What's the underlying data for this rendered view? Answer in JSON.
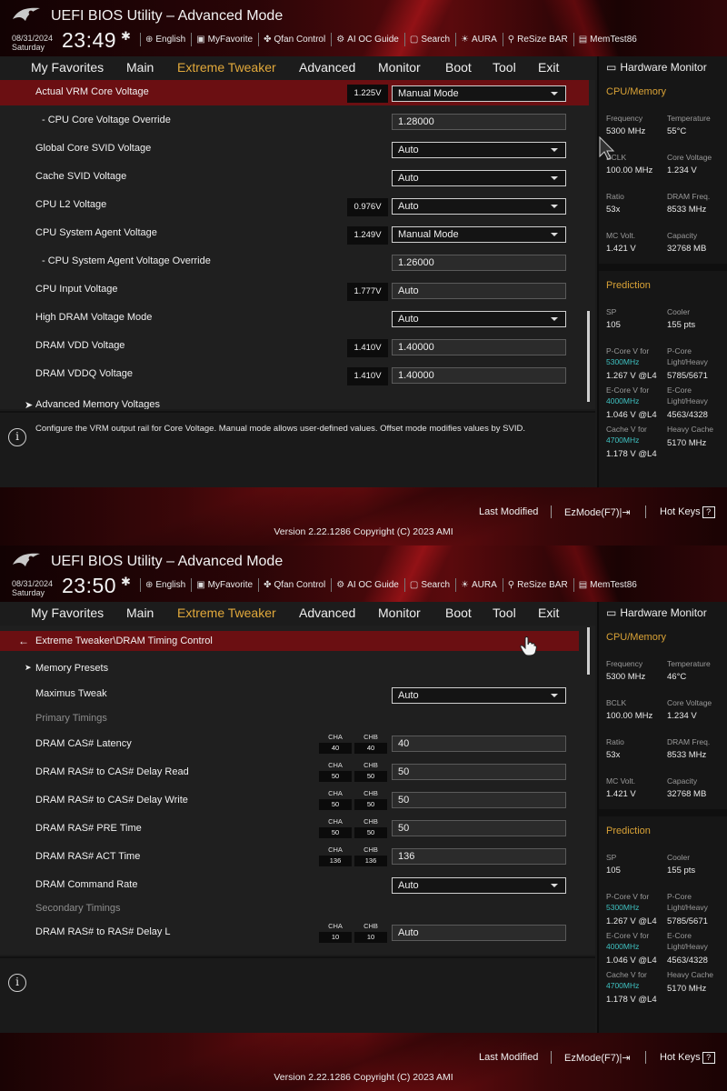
{
  "header": {
    "title": "UEFI BIOS Utility – Advanced Mode",
    "tools": [
      "English",
      "MyFavorite",
      "Qfan Control",
      "AI OC Guide",
      "Search",
      "AURA",
      "ReSize BAR",
      "MemTest86"
    ]
  },
  "nav": {
    "tabs": [
      "My Favorites",
      "Main",
      "Extreme Tweaker",
      "Advanced",
      "Monitor",
      "Boot",
      "Tool",
      "Exit"
    ],
    "active": "Extreme Tweaker"
  },
  "screen1": {
    "date": "08/31/2024",
    "day": "Saturday",
    "time": "23:49",
    "rows": [
      {
        "label": "Actual VRM Core Voltage",
        "reading": "1.225V",
        "value": "Manual Mode",
        "kind": "dropdown",
        "selected": true
      },
      {
        "label": "- CPU Core Voltage Override",
        "reading": "",
        "value": "1.28000",
        "kind": "field"
      },
      {
        "label": "Global Core SVID Voltage",
        "reading": "",
        "value": "Auto",
        "kind": "dropdown"
      },
      {
        "label": "Cache SVID Voltage",
        "reading": "",
        "value": "Auto",
        "kind": "dropdown"
      },
      {
        "label": "CPU L2 Voltage",
        "reading": "0.976V",
        "value": "Auto",
        "kind": "dropdown"
      },
      {
        "label": "CPU System Agent Voltage",
        "reading": "1.249V",
        "value": "Manual Mode",
        "kind": "dropdown"
      },
      {
        "label": "- CPU System Agent Voltage Override",
        "reading": "",
        "value": "1.26000",
        "kind": "field"
      },
      {
        "label": "CPU Input Voltage",
        "reading": "1.777V",
        "value": "Auto",
        "kind": "field"
      },
      {
        "label": "High DRAM Voltage Mode",
        "reading": "",
        "value": "Auto",
        "kind": "dropdown"
      },
      {
        "label": "DRAM VDD Voltage",
        "reading": "1.410V",
        "value": "1.40000",
        "kind": "field"
      },
      {
        "label": "DRAM VDDQ Voltage",
        "reading": "1.410V",
        "value": "1.40000",
        "kind": "field"
      }
    ],
    "submenu_partial": "Advanced Memory Voltages",
    "help": "Configure the VRM output rail for Core Voltage. Manual mode allows user-defined values. Offset mode modifies values by SVID.",
    "hw": {
      "frequency": "5300 MHz",
      "temperature": "55°C",
      "bclk": "100.00 MHz",
      "core_voltage": "1.234 V",
      "ratio": "53x",
      "dram_freq": "8533 MHz",
      "mc_volt": "1.421 V",
      "capacity": "32768 MB"
    }
  },
  "screen2": {
    "date": "08/31/2024",
    "day": "Saturday",
    "time": "23:50",
    "breadcrumb": "Extreme Tweaker\\DRAM Timing Control",
    "memory_presets": "Memory Presets",
    "maximus_tweak": {
      "label": "Maximus Tweak",
      "value": "Auto"
    },
    "group_primary": "Primary Timings",
    "group_secondary": "Secondary Timings",
    "timings": [
      {
        "label": "DRAM CAS# Latency",
        "cha": "40",
        "chb": "40",
        "value": "40",
        "kind": "field"
      },
      {
        "label": "DRAM RAS# to CAS# Delay Read",
        "cha": "50",
        "chb": "50",
        "value": "50",
        "kind": "field"
      },
      {
        "label": "DRAM RAS# to CAS# Delay Write",
        "cha": "50",
        "chb": "50",
        "value": "50",
        "kind": "field"
      },
      {
        "label": "DRAM RAS# PRE Time",
        "cha": "50",
        "chb": "50",
        "value": "50",
        "kind": "field"
      },
      {
        "label": "DRAM RAS# ACT Time",
        "cha": "136",
        "chb": "136",
        "value": "136",
        "kind": "field"
      }
    ],
    "command_rate": {
      "label": "DRAM Command Rate",
      "value": "Auto"
    },
    "rrd_l": {
      "label": "DRAM RAS# to RAS# Delay L",
      "cha": "10",
      "chb": "10",
      "value": "Auto"
    },
    "hw": {
      "frequency": "5300 MHz",
      "temperature": "46°C",
      "bclk": "100.00 MHz",
      "core_voltage": "1.234 V",
      "ratio": "53x",
      "dram_freq": "8533 MHz",
      "mc_volt": "1.421 V",
      "capacity": "32768 MB"
    }
  },
  "hwlabels": {
    "title": "Hardware Monitor",
    "cpu_mem": "CPU/Memory",
    "frequency": "Frequency",
    "temperature": "Temperature",
    "bclk": "BCLK",
    "core_voltage": "Core Voltage",
    "ratio": "Ratio",
    "dram_freq": "DRAM Freq.",
    "mc_volt": "MC Volt.",
    "capacity": "Capacity",
    "prediction": "Prediction",
    "sp": "SP",
    "cooler": "Cooler"
  },
  "prediction": {
    "sp": "105",
    "cooler": "155 pts",
    "pcore_label": "P-Core V for",
    "pcore_freq": "5300MHz",
    "pcore_val": "1.267 V @L4",
    "pcore_lh_label": "P-Core Light/Heavy",
    "pcore_lh": "5785/5671",
    "ecore_label": "E-Core V for",
    "ecore_freq": "4000MHz",
    "ecore_val": "1.046 V @L4",
    "ecore_lh_label": "E-Core Light/Heavy",
    "ecore_lh": "4563/4328",
    "cache_label": "Cache V for",
    "cache_freq": "4700MHz",
    "cache_val": "1.178 V @L4",
    "cache_hc_label": "Heavy Cache",
    "cache_hc": "5170 MHz"
  },
  "footer": {
    "last_modified": "Last Modified",
    "ezmode": "EzMode(F7)",
    "hotkeys": "Hot Keys",
    "version": "Version 2.22.1286 Copyright (C) 2023 AMI"
  },
  "channel_labels": {
    "cha": "CHA",
    "chb": "CHB"
  },
  "colors": {
    "accent": "#e2a93b",
    "selected_row": "#6b0f12",
    "prediction_blue": "#3fc2c2"
  }
}
